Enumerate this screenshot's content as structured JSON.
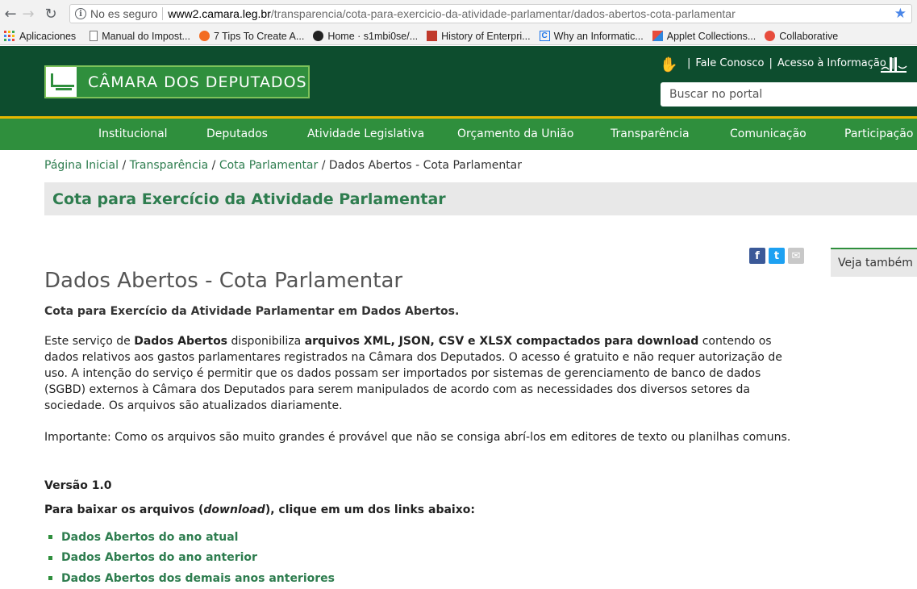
{
  "browser": {
    "security_text": "No es seguro",
    "url_host": "www2.camara.leg.br",
    "url_path": "/transparencia/cota-para-exercicio-da-atividade-parlamentar/dados-abertos-cota-parlamentar",
    "bookmarks": [
      "Aplicaciones",
      "Manual do Impost...",
      "7 Tips To Create A...",
      "Home · s1mbi0se/...",
      "History of Enterpri...",
      "Why an Informatic...",
      "Applet Collections...",
      "Collaborative"
    ]
  },
  "header": {
    "logo_text": "CÂMARA DOS DEPUTADOS",
    "links": [
      "Fale Conosco",
      "Acesso à Informação"
    ],
    "search_placeholder": "Buscar no portal"
  },
  "nav": {
    "items": [
      "Institucional",
      "Deputados",
      "Atividade Legislativa",
      "Orçamento da União",
      "Transparência",
      "Comunicação",
      "Participação"
    ]
  },
  "breadcrumb": {
    "items": [
      "Página Inicial",
      "Transparência",
      "Cota Parlamentar"
    ],
    "current": "Dados Abertos - Cota Parlamentar",
    "separator": " / "
  },
  "banner_title": "Cota para Exercício da Atividade Parlamentar",
  "sidebar": {
    "veja_tambem": "Veja também"
  },
  "content": {
    "title": "Dados Abertos - Cota Parlamentar",
    "lead": "Cota para Exercício da Atividade Parlamentar em Dados Abertos.",
    "para_1": "Este serviço de ",
    "para_b1": "Dados Abertos",
    "para_2": " disponibiliza ",
    "para_b2": "arquivos XML, JSON, CSV e XLSX compactados para download",
    "para_3": " contendo os dados relativos aos gastos parlamentares registrados na Câmara dos Deputados. O acesso é gratuito e não requer autorização de uso. A intenção do serviço é permitir que os dados possam ser importados por sistemas de gerenciamento de banco de dados (SGBD) externos à Câmara dos Deputados para serem manipulados de acordo com as necessidades dos diversos setores da sociedade. Os arquivos são atualizados diariamente.",
    "important": "Importante: Como os arquivos são muito grandes é provável que não se consiga abrí-los em editores de texto ou planilhas comuns.",
    "version": "Versão 1.0",
    "dl_pre": "Para baixar os arquivos (",
    "dl_em": "download",
    "dl_post": "), clique em um dos links abaixo:",
    "links": [
      "Dados Abertos do ano atual",
      "Dados Abertos do ano anterior",
      "Dados Abertos dos demais anos anteriores"
    ]
  }
}
